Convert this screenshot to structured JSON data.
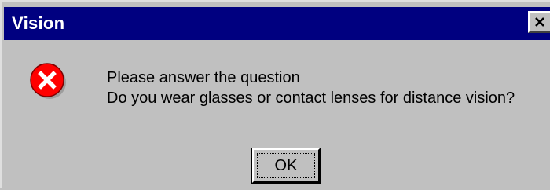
{
  "window": {
    "title": "Vision",
    "close_label": "×"
  },
  "dialog": {
    "icon": "error-icon",
    "message_line1": "Please answer the question",
    "message_line2": "Do you wear glasses or contact lenses for distance vision?",
    "ok_label": "OK"
  },
  "colors": {
    "titlebar": "#000080",
    "face": "#c0c0c0",
    "error_red": "#ff0000"
  }
}
